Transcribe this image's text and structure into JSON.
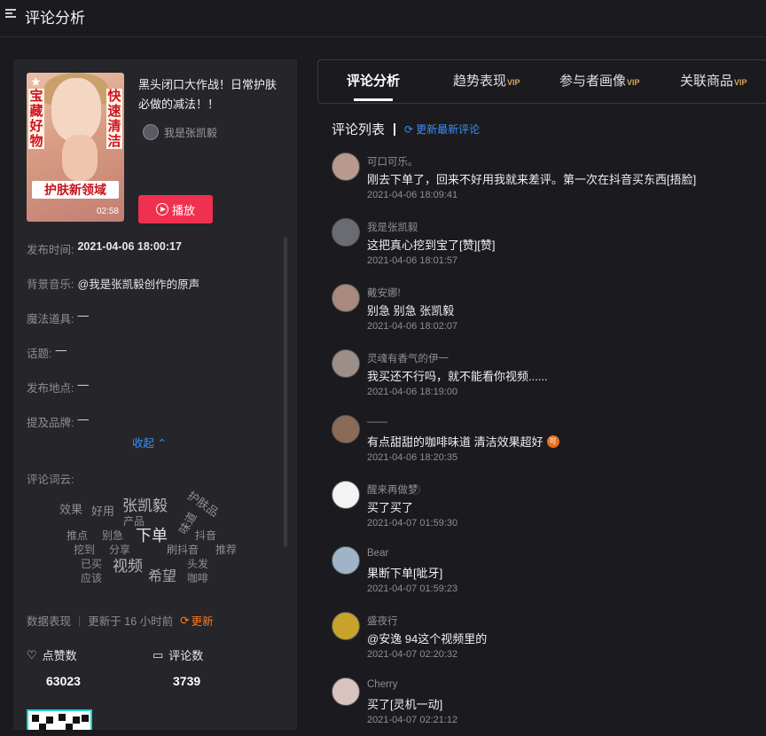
{
  "page": {
    "title": "评论分析"
  },
  "video": {
    "thumb_side_left": "宝藏好物",
    "thumb_side_right": "快速清洁",
    "thumb_banner": "护肤新领域",
    "duration": "02:58",
    "title": "黑头闭口大作战！日常护肤必做的减法！！",
    "author": "我是张凯毅",
    "play_label": "播放"
  },
  "meta": [
    {
      "key": "发布时间:",
      "value": "2021-04-06 18:00:17",
      "bold": true
    },
    {
      "key": "背景音乐:",
      "value": "@我是张凯毅创作的原声",
      "bold": false
    },
    {
      "key": "魔法道具:",
      "value": "—",
      "bold": false
    },
    {
      "key": "话题:",
      "value": "—",
      "bold": false
    },
    {
      "key": "发布地点:",
      "value": "—",
      "bold": false
    },
    {
      "key": "提及品牌:",
      "value": "—",
      "bold": false
    }
  ],
  "collapse_label": "收起",
  "word_cloud": {
    "label": "评论词云:",
    "words": [
      "效果",
      "好用",
      "张凯毅",
      "护肤品",
      "产品",
      "味道",
      "推点",
      "别急",
      "下单",
      "抖音",
      "挖到",
      "分享",
      "刷抖音",
      "推荐",
      "已买",
      "视频",
      "头发",
      "应该",
      "希望",
      "咖啡"
    ]
  },
  "stats": {
    "label": "数据表现",
    "updated": "更新于 16 小时前",
    "refresh_label": "更新",
    "likes_label": "点赞数",
    "likes_value": "63023",
    "comments_label": "评论数",
    "comments_value": "3739"
  },
  "tabs": [
    {
      "label": "评论分析",
      "vip": ""
    },
    {
      "label": "趋势表现",
      "vip": "VIP"
    },
    {
      "label": "参与者画像",
      "vip": "VIP"
    },
    {
      "label": "关联商品",
      "vip": "VIP"
    }
  ],
  "comment_list": {
    "title": "评论列表",
    "update_label": "更新最新评论",
    "items": [
      {
        "user": "可口可乐。",
        "text": "刚去下单了，回来不好用我就来差评。第一次在抖音买东西[捂脸]",
        "time": "2021-04-06 18:09:41",
        "avatar_color": "#b89a8c",
        "badge": ""
      },
      {
        "user": "我是张凯毅",
        "text": "这把真心挖到宝了[赞][赞]",
        "time": "2021-04-06 18:01:57",
        "avatar_color": "#6b6b73",
        "badge": ""
      },
      {
        "user": "戴安娜!",
        "text": "别急 别急 张凯毅",
        "time": "2021-04-06 18:02:07",
        "avatar_color": "#a8897e",
        "badge": ""
      },
      {
        "user": "灵魂有香气的伊一",
        "text": "我买还不行吗，就不能看你视频......",
        "time": "2021-04-06 18:19:00",
        "avatar_color": "#9c8f8a",
        "badge": ""
      },
      {
        "user": "——",
        "text": "有点甜甜的咖啡味道 清洁效果超好",
        "time": "2021-04-06 18:20:35",
        "avatar_color": "#8a6b58",
        "badge": "可"
      },
      {
        "user": "醒来再做梦 ⃝",
        "text": "买了买了",
        "time": "2021-04-07 01:59:30",
        "avatar_color": "#f3f3f3",
        "badge": ""
      },
      {
        "user": "Bear",
        "text": "果断下单[呲牙]",
        "time": "2021-04-07 01:59:23",
        "avatar_color": "#9fb4c9",
        "badge": ""
      },
      {
        "user": "盛夜行",
        "text": "@安逸 94这个视频里的",
        "time": "2021-04-07 02:20:32",
        "avatar_color": "#c8a22a",
        "badge": ""
      },
      {
        "user": "Cherry",
        "text": "买了[灵机一动]",
        "time": "2021-04-07 02:21:12",
        "avatar_color": "#d9c3c0",
        "badge": ""
      }
    ]
  },
  "colors": {
    "accent_blue": "#3a8ff5",
    "play_red": "#f0304f",
    "refresh_orange": "#ff7a1a",
    "vip_gold": "#d6a75c"
  }
}
